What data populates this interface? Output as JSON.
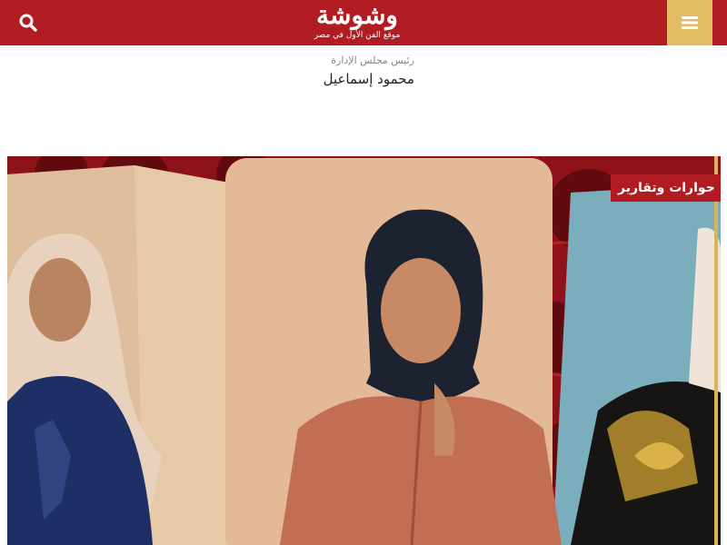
{
  "header": {
    "logo_text": "وشوشة",
    "logo_tagline": "موقع الفن الأول في مصر",
    "search_icon": "search-icon",
    "menu_icon": "hamburger-menu-icon",
    "bar_color": "#b01c22",
    "menu_button_color": "#e2bd63"
  },
  "chairman": {
    "role": "رئيس مجلس الإدارة",
    "name": "محمود إسماعيل"
  },
  "featured": {
    "category": "حوارات وتقارير",
    "badge_color": "#b01c22",
    "accent_color": "#d9b55a"
  }
}
